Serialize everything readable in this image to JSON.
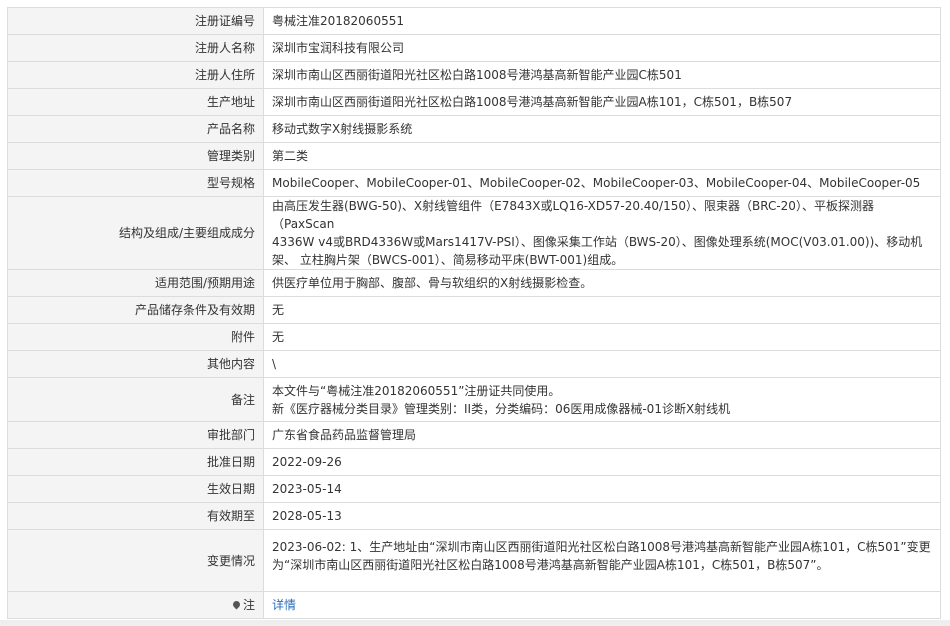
{
  "rows": [
    {
      "label": "注册证编号",
      "value": "粤械注准20182060551"
    },
    {
      "label": "注册人名称",
      "value": "深圳市宝润科技有限公司"
    },
    {
      "label": "注册人住所",
      "value": "深圳市南山区西丽街道阳光社区松白路1008号港鸿基高新智能产业园C栋501"
    },
    {
      "label": "生产地址",
      "value": "深圳市南山区西丽街道阳光社区松白路1008号港鸿基高新智能产业园A栋101，C栋501，B栋507"
    },
    {
      "label": "产品名称",
      "value": "移动式数字X射线摄影系统"
    },
    {
      "label": "管理类别",
      "value": "第二类"
    },
    {
      "label": "型号规格",
      "value": "MobileCooper、MobileCooper-01、MobileCooper-02、MobileCooper-03、MobileCooper-04、MobileCooper-05"
    },
    {
      "label": "结构及组成/主要组成成分",
      "lines": [
        "由高压发生器(BWG-50)、X射线管组件（E7843X或LQ16-XD57-20.40/150）、限束器（BRC-20）、平板探测器（PaxScan",
        "4336W v4或BRD4336W或Mars1417V-PSI）、图像采集工作站（BWS-20）、图像处理系统(MOC(V03.01.00))、移动机",
        "架、 立柱胸片架（BWCS-001）、简易移动平床(BWT-001)组成。"
      ]
    },
    {
      "label": "适用范围/预期用途",
      "value": "供医疗单位用于胸部、腹部、骨与软组织的X射线摄影检查。"
    },
    {
      "label": "产品储存条件及有效期",
      "value": "无"
    },
    {
      "label": "附件",
      "value": "无"
    },
    {
      "label": "其他内容",
      "value": "\\"
    },
    {
      "label": "备注",
      "lines": [
        "本文件与“粤械注准20182060551”注册证共同使用。",
        "新《医疗器械分类目录》管理类别：II类，分类编码：06医用成像器械-01诊断X射线机"
      ]
    },
    {
      "label": "审批部门",
      "value": "广东省食品药品监督管理局"
    },
    {
      "label": "批准日期",
      "value": "2022-09-26"
    },
    {
      "label": "生效日期",
      "value": "2023-05-14"
    },
    {
      "label": "有效期至",
      "value": "2028-05-13"
    },
    {
      "label": "变更情况",
      "lines": [
        "2023-06-02: 1、生产地址由“深圳市南山区西丽街道阳光社区松白路1008号港鸿基高新智能产业园A栋101，C栋501”变更",
        "为“深圳市南山区西丽街道阳光社区松白路1008号港鸿基高新智能产业园A栋101，C栋501，B栋507”。"
      ]
    }
  ],
  "note": {
    "label": "注",
    "icon": "pin-icon",
    "link_text": "详情"
  },
  "colors": {
    "label_bg": "#f4f4f4",
    "border": "#dcdcdc",
    "link": "#2a6ebb"
  }
}
